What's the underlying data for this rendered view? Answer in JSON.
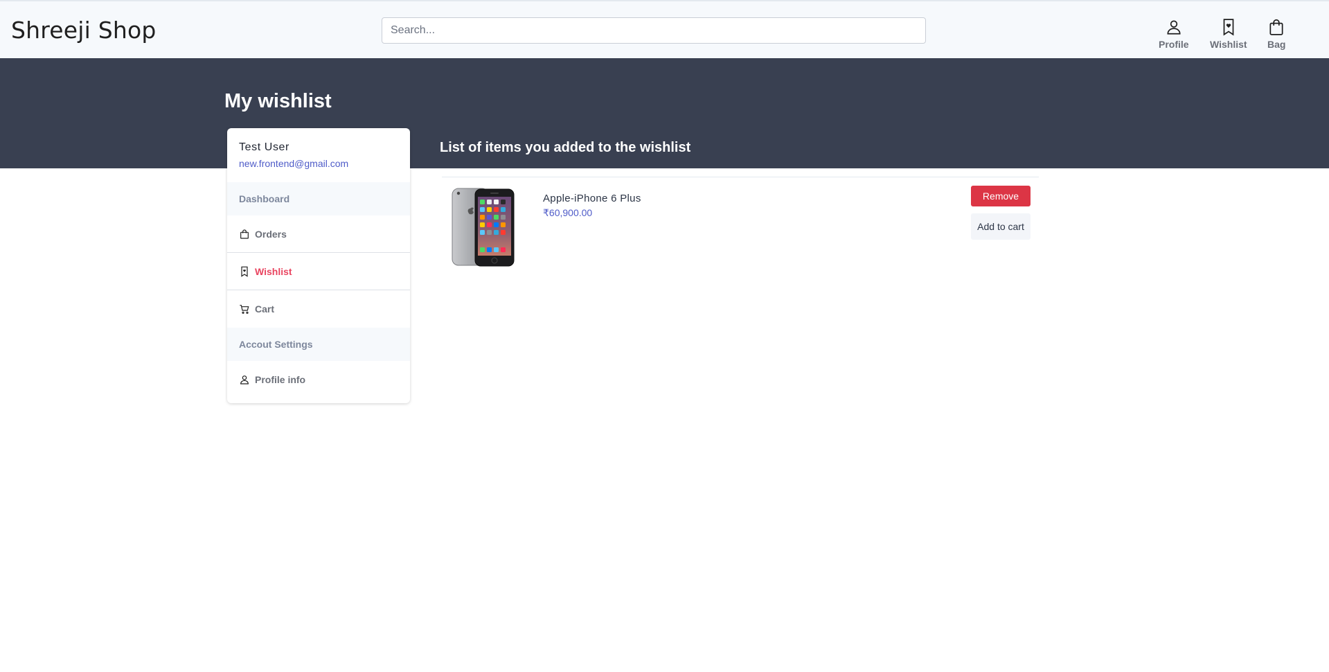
{
  "header": {
    "brand": "Shreeji Shop",
    "search_placeholder": "Search...",
    "search_value": "",
    "nav": {
      "profile": "Profile",
      "wishlist": "Wishlist",
      "bag": "Bag"
    }
  },
  "page": {
    "title": "My wishlist",
    "section_title": "List of items you added to the wishlist"
  },
  "sidebar": {
    "user_name": "Test User",
    "user_email": "new.frontend@gmail.com",
    "dashboard_heading": "Dashboard",
    "orders_label": "Orders",
    "wishlist_label": "Wishlist",
    "cart_label": "Cart",
    "settings_heading": "Accout Settings",
    "profile_info_label": "Profile info"
  },
  "wishlist": {
    "items": [
      {
        "name": "Apple-iPhone 6 Plus",
        "price": "₹60,900.00",
        "remove_label": "Remove",
        "add_to_cart_label": "Add to cart"
      }
    ]
  },
  "colors": {
    "banner": "#394051",
    "active_link": "#e94560",
    "remove_button": "#dc3545",
    "price": "#4e5bc8"
  },
  "icons": [
    "user-icon",
    "bookmark-icon",
    "bag-icon",
    "cart-icon"
  ]
}
